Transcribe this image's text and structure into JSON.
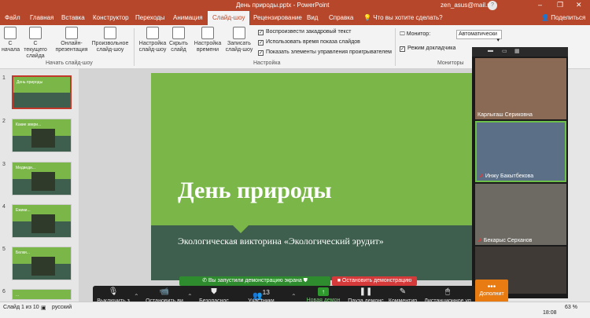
{
  "window": {
    "title": "День природы.pptx - PowerPoint",
    "user": "zen_asus@mail.ru",
    "avatar_letter": "?"
  },
  "tabs": [
    "Файл",
    "Главная",
    "Вставка",
    "Конструктор",
    "Переходы",
    "Анимация",
    "Слайд-шоу",
    "Рецензирование",
    "Вид",
    "Справка"
  ],
  "tell_me": "Что вы хотите сделать?",
  "share_label": "Поделиться",
  "ribbon": {
    "btn_from_start": "С начала",
    "btn_from_current": "С текущего слайда",
    "btn_online": "Онлайн-презентация",
    "btn_custom": "Произвольное слайд-шоу",
    "group_start": "Начать слайд-шоу",
    "btn_setup": "Настройка слайд-шоу",
    "btn_hide": "Скрыть слайд",
    "btn_rehearse": "Настройка времени",
    "btn_record": "Записать слайд-шоу",
    "chk_narration": "Воспроизвести закадровый текст",
    "chk_timings": "Использовать время показа слайдов",
    "chk_media": "Показать элементы управления проигрывателем",
    "group_setup": "Настройка",
    "monitor_label": "Монитор:",
    "monitor_value": "Автоматически",
    "chk_presenter": "Режим докладчика",
    "group_monitors": "Мониторы"
  },
  "thumbs": [
    {
      "num": "1",
      "title": "День природы"
    },
    {
      "num": "2",
      "title": "Какие звери..."
    },
    {
      "num": "3",
      "title": "Медведи..."
    },
    {
      "num": "4",
      "title": "Ежики..."
    },
    {
      "num": "5",
      "title": "Белки..."
    },
    {
      "num": "6",
      "title": "..."
    }
  ],
  "slide": {
    "title": "День природы",
    "subtitle": "Экологическая викторина «Экологический эрудит»"
  },
  "share_banner": "Вы запустили демонстрацию экрана",
  "stop_share": "Остановить демонстрацию",
  "zoom": {
    "mute": "Выключить з",
    "video": "Остановить ви",
    "security": "Безопаснос",
    "participants": "Участники",
    "participants_count": "13",
    "new_share": "Новая демон",
    "pause": "Пауза демонс",
    "annotate": "Комментир",
    "remote": "Дистанционное уп",
    "more": "Дополнит"
  },
  "gallery": [
    {
      "name": "Карлыгаш Сериковна",
      "muted": false
    },
    {
      "name": "Инжу Бакытбекова",
      "muted": true
    },
    {
      "name": "Бекарыс Серханов",
      "muted": true
    },
    {
      "name": "",
      "muted": false
    }
  ],
  "status": {
    "slide_of": "Слайд 1 из 10",
    "language": "русский",
    "zoom_level": "63 %",
    "time": "18:08"
  }
}
